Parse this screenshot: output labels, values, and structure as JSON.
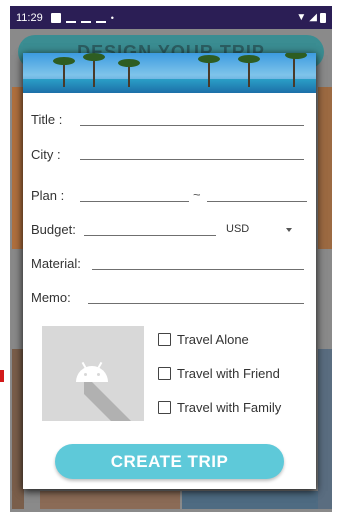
{
  "status_bar": {
    "time": "11:29"
  },
  "background": {
    "title": "DESIGN YOUR TRIP"
  },
  "form": {
    "title_label": "Title :",
    "city_label": "City :",
    "plan_label": "Plan :",
    "plan_separator": "~",
    "budget_label": "Budget:",
    "currency": "USD",
    "material_label": "Material:",
    "memo_label": "Memo:",
    "checkboxes": [
      {
        "label": "Travel Alone",
        "checked": false
      },
      {
        "label": "Travel with Friend",
        "checked": false
      },
      {
        "label": "Travel with Family",
        "checked": false
      }
    ],
    "create_button": "CREATE TRIP"
  },
  "colors": {
    "status_bar": "#2b1e55",
    "button": "#5ec9d9",
    "background_title": "#3b8d92"
  }
}
